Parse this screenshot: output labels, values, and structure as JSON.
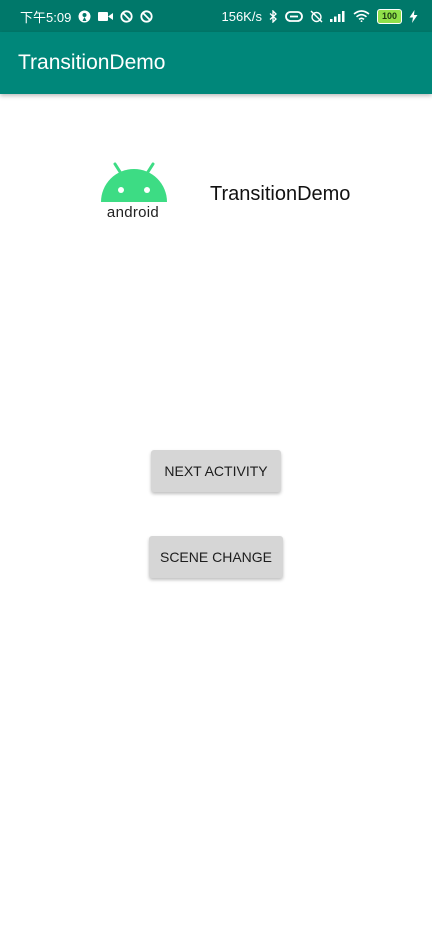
{
  "status_bar": {
    "time": "下午5:09",
    "net_speed": "156K/s",
    "battery": "100",
    "icons_left": [
      "location-icon",
      "video-icon",
      "block-icon",
      "block-icon"
    ],
    "icons_right": [
      "bluetooth-icon",
      "link-icon",
      "alarm-off-icon",
      "signal-icon",
      "wifi-icon",
      "battery-icon",
      "charging-icon"
    ]
  },
  "app_bar": {
    "title": "TransitionDemo",
    "color": "#00877a"
  },
  "header": {
    "logo_word": "android",
    "logo_color": "#3ddc84",
    "title": "TransitionDemo"
  },
  "buttons": {
    "next_activity": "NEXT ACTIVITY",
    "scene_change": "SCENE CHANGE"
  }
}
